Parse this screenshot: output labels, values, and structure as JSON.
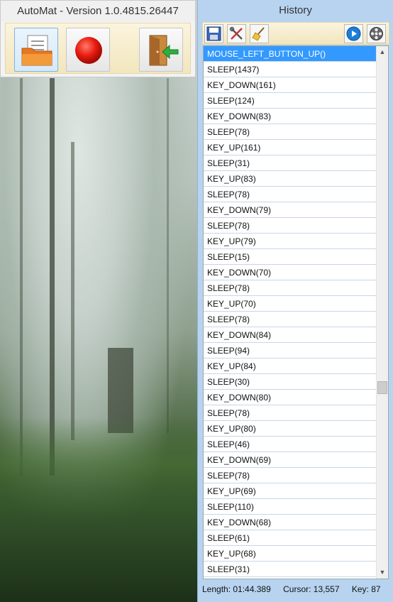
{
  "main_window": {
    "title": "AutoMat - Version 1.0.4815.26447",
    "toolbar": {
      "open_icon": "open-file-icon",
      "record_icon": "record-icon",
      "exit_icon": "exit-door-icon"
    }
  },
  "history": {
    "title": "History",
    "toolbar": {
      "save_icon": "save-icon",
      "edit_icon": "tools-icon",
      "clear_icon": "broom-icon",
      "play_icon": "play-icon",
      "settings_icon": "film-reel-icon"
    },
    "entries": [
      "MOUSE_LEFT_BUTTON_UP()",
      "SLEEP(1437)",
      "KEY_DOWN(161)",
      "SLEEP(124)",
      "KEY_DOWN(83)",
      "SLEEP(78)",
      "KEY_UP(161)",
      "SLEEP(31)",
      "KEY_UP(83)",
      "SLEEP(78)",
      "KEY_DOWN(79)",
      "SLEEP(78)",
      "KEY_UP(79)",
      "SLEEP(15)",
      "KEY_DOWN(70)",
      "SLEEP(78)",
      "KEY_UP(70)",
      "SLEEP(78)",
      "KEY_DOWN(84)",
      "SLEEP(94)",
      "KEY_UP(84)",
      "SLEEP(30)",
      "KEY_DOWN(80)",
      "SLEEP(78)",
      "KEY_UP(80)",
      "SLEEP(46)",
      "KEY_DOWN(69)",
      "SLEEP(78)",
      "KEY_UP(69)",
      "SLEEP(110)",
      "KEY_DOWN(68)",
      "SLEEP(61)",
      "KEY_UP(68)",
      "SLEEP(31)"
    ],
    "selected_index": 0,
    "status": {
      "length": "Length: 01:44.389",
      "cursor": "Cursor: 13,557",
      "key": "Key: 87"
    }
  },
  "colors": {
    "selection": "#3399ff",
    "panel_bg": "#b7d3f0",
    "toolbar_bg": "#f2e6bd"
  }
}
